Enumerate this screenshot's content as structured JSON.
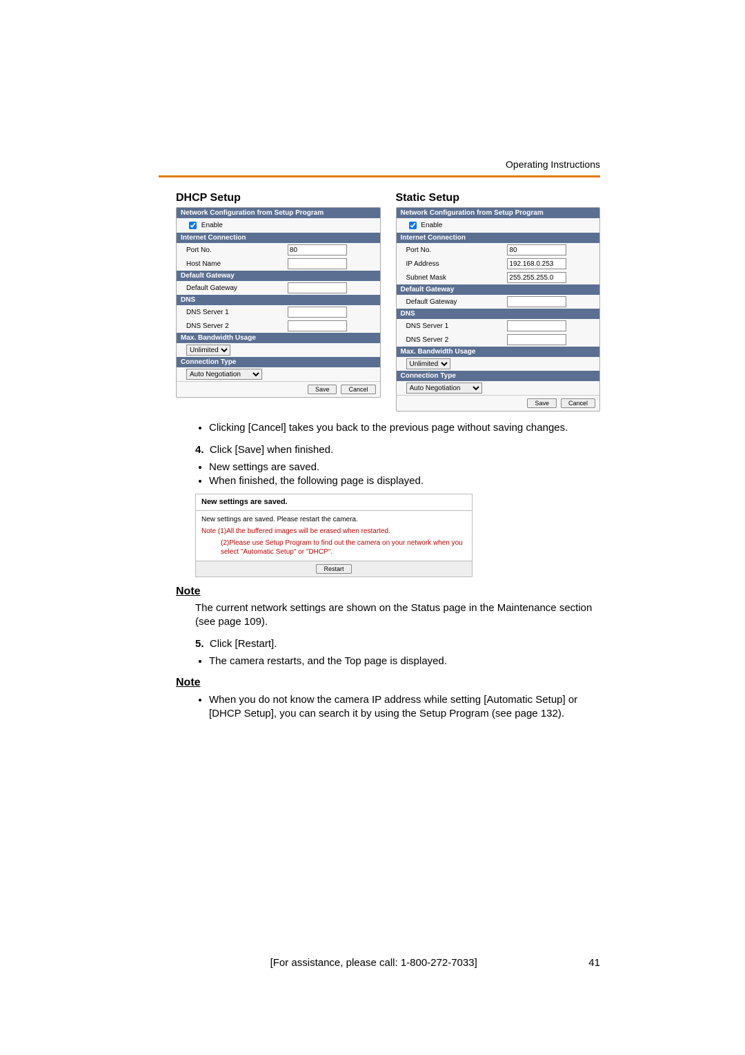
{
  "header": {
    "operating": "Operating Instructions"
  },
  "titles": {
    "dhcp": "DHCP Setup",
    "static": "Static Setup"
  },
  "sections": {
    "netcfg": "Network Configuration from Setup Program",
    "enable": "Enable",
    "internet": "Internet Connection",
    "port": "Port No.",
    "host": "Host Name",
    "ip": "IP Address",
    "mask": "Subnet Mask",
    "gateway_hdr": "Default Gateway",
    "gateway": "Default Gateway",
    "dns_hdr": "DNS",
    "dns1": "DNS Server 1",
    "dns2": "DNS Server 2",
    "bw_hdr": "Max. Bandwidth Usage",
    "conn_hdr": "Connection Type"
  },
  "values": {
    "port": "80",
    "ip": "192.168.0.253",
    "mask": "255.255.255.0",
    "bw": "Unlimited",
    "conn": "Auto Negotiation"
  },
  "buttons": {
    "save": "Save",
    "cancel": "Cancel",
    "restart": "Restart"
  },
  "body": {
    "bullet_cancel": "Clicking [Cancel] takes you back to the previous page without saving changes.",
    "step4": "Click [Save] when finished.",
    "step4_b1": "New settings are saved.",
    "step4_b2": "When finished, the following page is displayed.",
    "saved_hdr": "New settings are saved.",
    "saved_line": "New settings are saved. Please restart the camera.",
    "saved_note1": "Note (1)All the buffered images will be erased when restarted.",
    "saved_note2": "(2)Please use Setup Program to find out the camera on your network when you select \"Automatic Setup\" or \"DHCP\".",
    "note1_hdr": "Note",
    "note1_text": "The current network settings are shown on the Status page in the Maintenance section (see page 109).",
    "step5": "Click [Restart].",
    "step5_b1": "The camera restarts, and the Top page is displayed.",
    "note2_hdr": "Note",
    "note2_text": "When you do not know the camera IP address while setting [Automatic Setup] or [DHCP Setup], you can search it by using the Setup Program (see page 132)."
  },
  "footer": {
    "assist": "[For assistance, please call: 1-800-272-7033]",
    "page": "41"
  }
}
